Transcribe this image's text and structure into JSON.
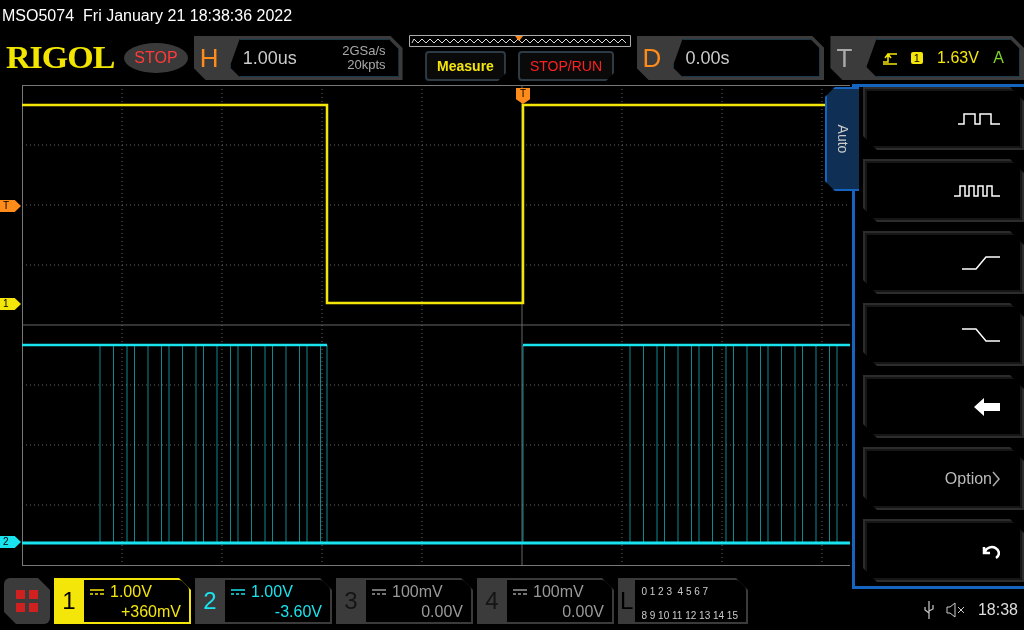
{
  "title": {
    "model": "MSO5074",
    "datetime": "Fri January 21 18:38:36 2022"
  },
  "logo": "RIGOL",
  "run_state": "STOP",
  "horizontal": {
    "label": "H",
    "timebase": "1.00us",
    "sample_rate": "2GSa/s",
    "memory_depth": "20kpts"
  },
  "buttons": [
    {
      "kind": "measure",
      "label": "Measure"
    },
    {
      "kind": "run",
      "label": "STOP/RUN"
    }
  ],
  "delay": {
    "label": "D",
    "value": "0.00s"
  },
  "trigger": {
    "label": "T",
    "source": "1",
    "voltage": "1.63V",
    "mode": "A"
  },
  "trigger_position_marker": "T",
  "markers": [
    {
      "label": "T",
      "color": "#ff8c1a"
    },
    {
      "label": "1",
      "color": "#f5e60a"
    },
    {
      "label": "2",
      "color": "#19e3ee"
    }
  ],
  "menu": {
    "tab": "Auto",
    "items": [
      {
        "kind": "single-pulse"
      },
      {
        "kind": "multi-pulse"
      },
      {
        "kind": "rise"
      },
      {
        "kind": "fall"
      },
      {
        "kind": "back"
      },
      {
        "kind": "text",
        "label": "Option"
      },
      {
        "kind": "undo"
      }
    ]
  },
  "channels": [
    {
      "number": "1",
      "scale": "1.00V",
      "offset": "+360mV",
      "color": "#f5e60a",
      "enabled": true,
      "selected": true
    },
    {
      "number": "2",
      "scale": "1.00V",
      "offset": "-3.60V",
      "color": "#19e3ee",
      "enabled": true,
      "selected": false
    },
    {
      "number": "3",
      "scale": "100mV",
      "offset": "0.00V",
      "enabled": false,
      "selected": false
    },
    {
      "number": "4",
      "scale": "100mV",
      "offset": "0.00V",
      "enabled": false,
      "selected": false
    }
  ],
  "logic": {
    "label": "L",
    "rows": [
      "0 1 2 3  4 5 6 7",
      "8 9 10 11 12 13 14 15"
    ]
  },
  "status": {
    "muted": true,
    "time": "18:38"
  }
}
